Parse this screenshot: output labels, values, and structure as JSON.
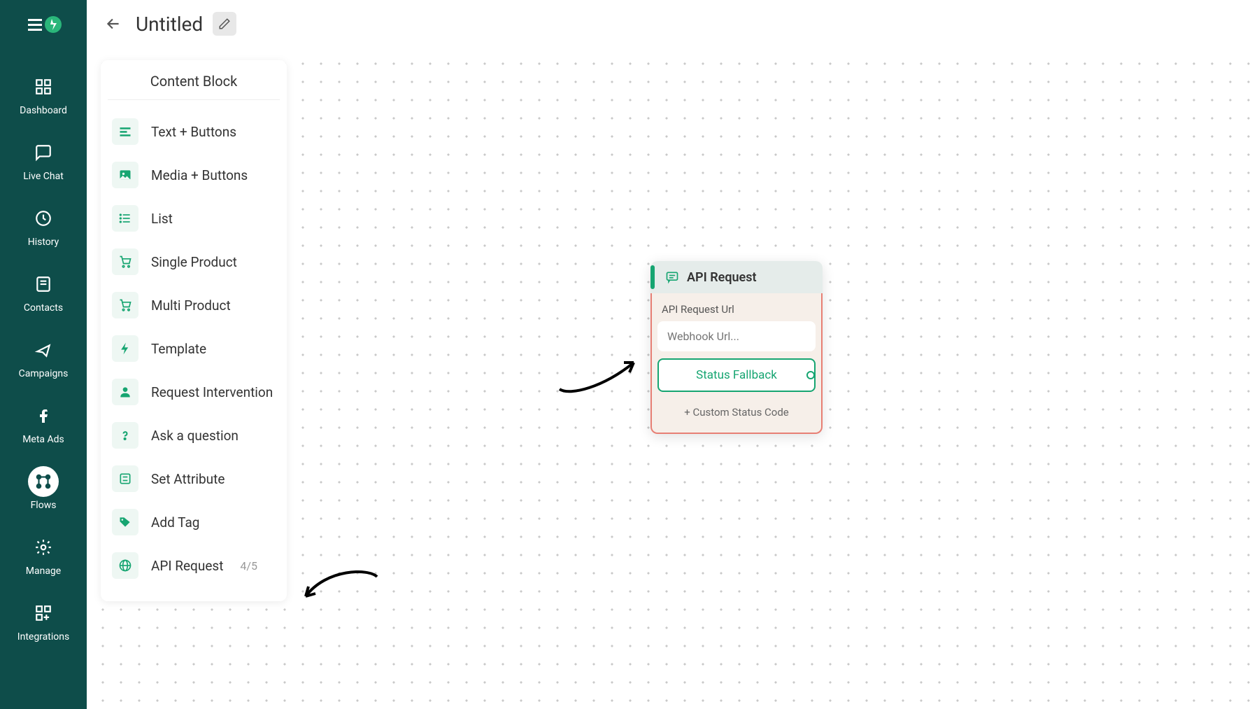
{
  "sidebar": {
    "items": [
      {
        "label": "Dashboard",
        "icon": "grid"
      },
      {
        "label": "Live Chat",
        "icon": "chat"
      },
      {
        "label": "History",
        "icon": "history"
      },
      {
        "label": "Contacts",
        "icon": "contacts"
      },
      {
        "label": "Campaigns",
        "icon": "send"
      },
      {
        "label": "Meta Ads",
        "icon": "facebook"
      },
      {
        "label": "Flows",
        "icon": "flows",
        "active": true
      },
      {
        "label": "Manage",
        "icon": "gear"
      },
      {
        "label": "Integrations",
        "icon": "apps"
      }
    ]
  },
  "topbar": {
    "title": "Untitled"
  },
  "content_panel": {
    "title": "Content Block",
    "items": [
      {
        "label": "Text + Buttons",
        "icon": "text"
      },
      {
        "label": "Media + Buttons",
        "icon": "media"
      },
      {
        "label": "List",
        "icon": "list"
      },
      {
        "label": "Single Product",
        "icon": "cart"
      },
      {
        "label": "Multi Product",
        "icon": "cart"
      },
      {
        "label": "Template",
        "icon": "bolt"
      },
      {
        "label": "Request Intervention",
        "icon": "person"
      },
      {
        "label": "Ask a question",
        "icon": "question"
      },
      {
        "label": "Set Attribute",
        "icon": "attr"
      },
      {
        "label": "Add Tag",
        "icon": "tag"
      },
      {
        "label": "API Request",
        "icon": "globe",
        "suffix": "4/5"
      }
    ]
  },
  "node": {
    "title": "API Request",
    "url_label": "API Request Url",
    "url_placeholder": "Webhook Url...",
    "status_fallback": "Status Fallback",
    "custom_status": "+ Custom Status Code"
  }
}
